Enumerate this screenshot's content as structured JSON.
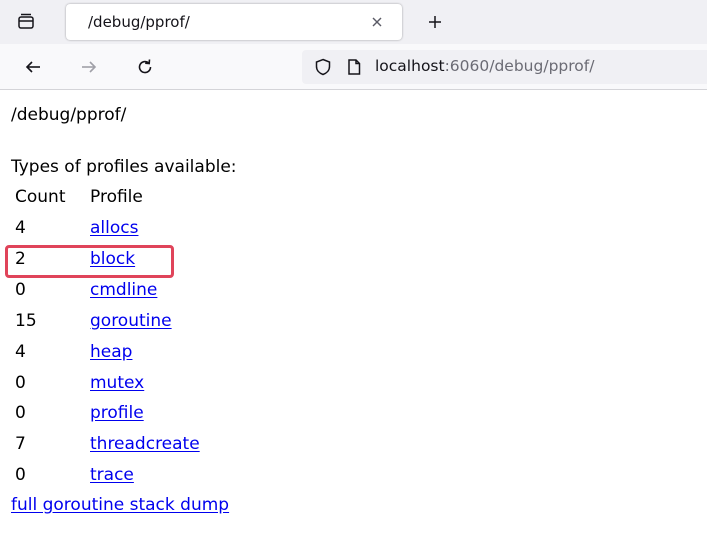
{
  "browser": {
    "tab": {
      "title": "/debug/pprof/"
    },
    "urlbar": {
      "host": "localhost",
      "rest": ":6060/debug/pprof/"
    },
    "icons": {
      "tab_list": "tab-list-icon",
      "close": "close-icon",
      "new_tab": "plus-icon",
      "back": "back-arrow-icon",
      "forward": "forward-arrow-icon",
      "reload": "reload-icon",
      "tracking": "shield-icon",
      "page": "page-icon"
    }
  },
  "page": {
    "path": "/debug/pprof/",
    "heading": "Types of profiles available:",
    "columns": {
      "count": "Count",
      "profile": "Profile"
    },
    "profiles": [
      {
        "count": "4",
        "name": "allocs"
      },
      {
        "count": "2",
        "name": "block"
      },
      {
        "count": "0",
        "name": "cmdline"
      },
      {
        "count": "15",
        "name": "goroutine"
      },
      {
        "count": "4",
        "name": "heap"
      },
      {
        "count": "0",
        "name": "mutex"
      },
      {
        "count": "0",
        "name": "profile"
      },
      {
        "count": "7",
        "name": "threadcreate"
      },
      {
        "count": "0",
        "name": "trace"
      }
    ],
    "full_dump": "full goroutine stack dump",
    "link_color": "#0000ee",
    "highlight_color": "#e0445a"
  }
}
